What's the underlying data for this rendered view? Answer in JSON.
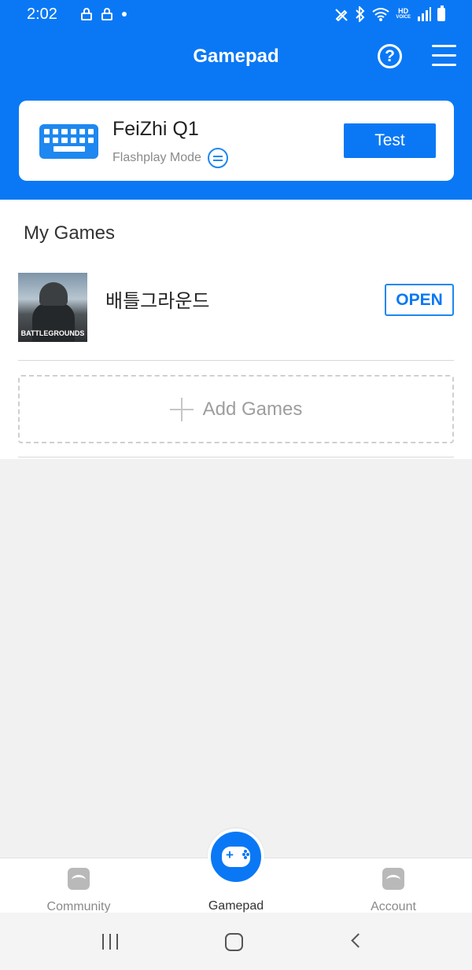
{
  "status_bar": {
    "time": "2:02",
    "hd_label": "HD",
    "voice_label": "VOICE",
    "icons": [
      "lock-icon",
      "lock-icon",
      "dot-icon",
      "pen-icon",
      "bluetooth-icon",
      "wifi-icon",
      "signal-icon",
      "battery-icon"
    ]
  },
  "header": {
    "title": "Gamepad",
    "help_icon": "?"
  },
  "device": {
    "name": "FeiZhi Q1",
    "mode": "Flashplay Mode",
    "test_label": "Test"
  },
  "my_games": {
    "title": "My Games",
    "games": [
      {
        "name": "배틀그라운드",
        "thumb_text": "BATTLEGROUNDS",
        "open_label": "OPEN"
      }
    ],
    "add_label": "Add Games"
  },
  "bottom_nav": {
    "items": [
      {
        "label": "Community",
        "icon": "community-icon"
      },
      {
        "label": "Gamepad",
        "icon": "gamepad-icon",
        "active": true
      },
      {
        "label": "Account",
        "icon": "account-icon"
      }
    ]
  },
  "colors": {
    "primary": "#0a78f5",
    "background": "#f1f1f1",
    "inactive_text": "#8a8a8a"
  }
}
